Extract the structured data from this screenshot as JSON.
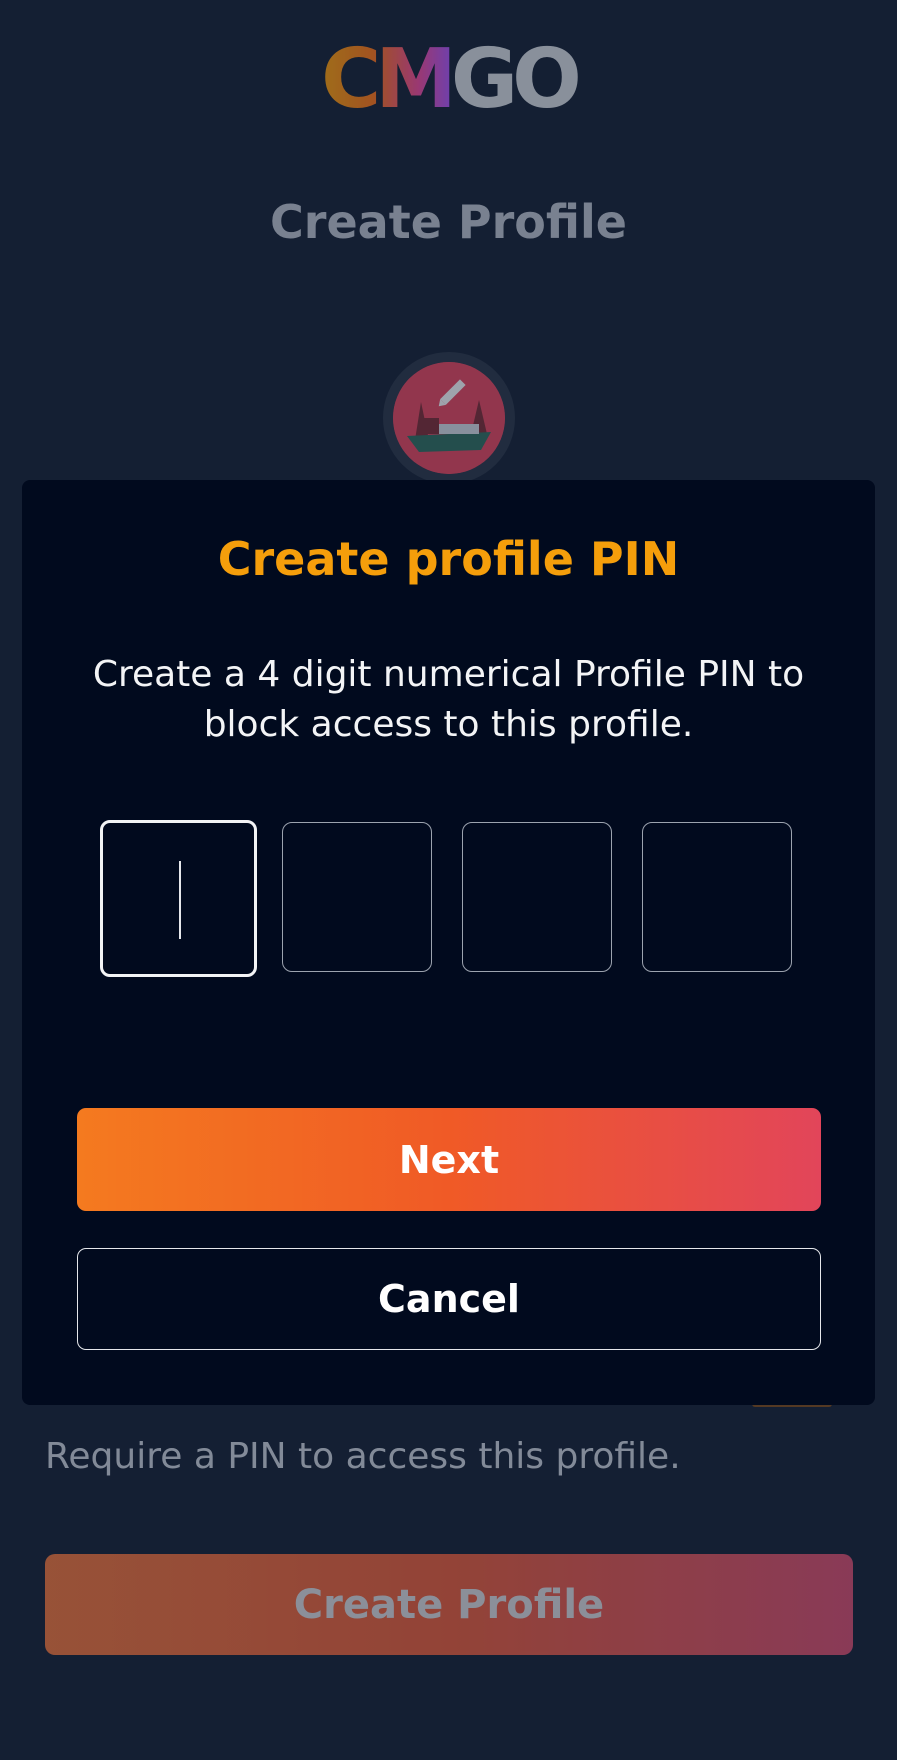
{
  "brand": {
    "logo_part1": "CM",
    "logo_part2": "GO"
  },
  "page": {
    "title": "Create Profile",
    "helper_text": "Require a PIN to access this profile.",
    "create_button_label": "Create Profile"
  },
  "modal": {
    "title": "Create profile PIN",
    "description": "Create a 4 digit numerical Profile PIN to block access to this profile.",
    "pin_digits": [
      "",
      "",
      "",
      ""
    ],
    "next_label": "Next",
    "cancel_label": "Cancel"
  },
  "colors": {
    "accent_orange": "#f59e0b",
    "primary_gradient_start": "#f47a1f",
    "primary_gradient_end": "#e2455a",
    "modal_bg": "#010a1e",
    "page_bg": "#141f33"
  },
  "icons": {
    "avatar": "boat-avatar",
    "avatar_edit": "pencil-icon"
  }
}
